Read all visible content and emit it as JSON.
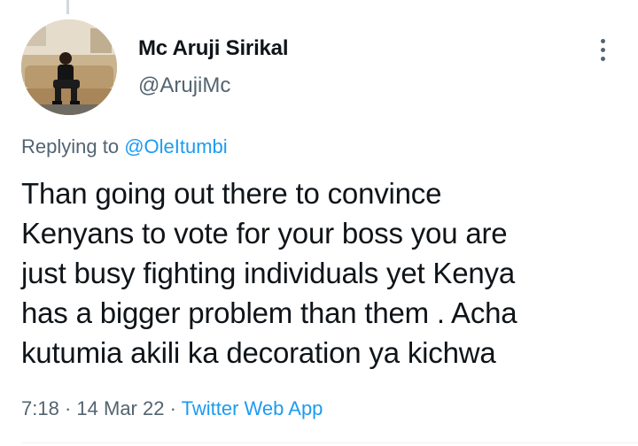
{
  "tweet": {
    "author": {
      "display_name": "Mc Aruji Sirikal",
      "handle": "@ArujiMc"
    },
    "replying_prefix": "Replying to",
    "replying_to": "@OleItumbi",
    "text_lines": [
      "Than going out there to convince",
      "Kenyans to vote for your boss you are",
      "just busy fighting individuals yet Kenya",
      "has a bigger problem than them . Acha",
      "kutumia akili ka decoration ya kichwa"
    ],
    "time": "7:18",
    "separator": "·",
    "date": "14 Mar 22",
    "source": "Twitter Web App"
  },
  "icons": {
    "more": "more-vertical-icon"
  },
  "colors": {
    "text_primary": "#0f1419",
    "text_secondary": "#536471",
    "accent": "#1d9bf0"
  }
}
